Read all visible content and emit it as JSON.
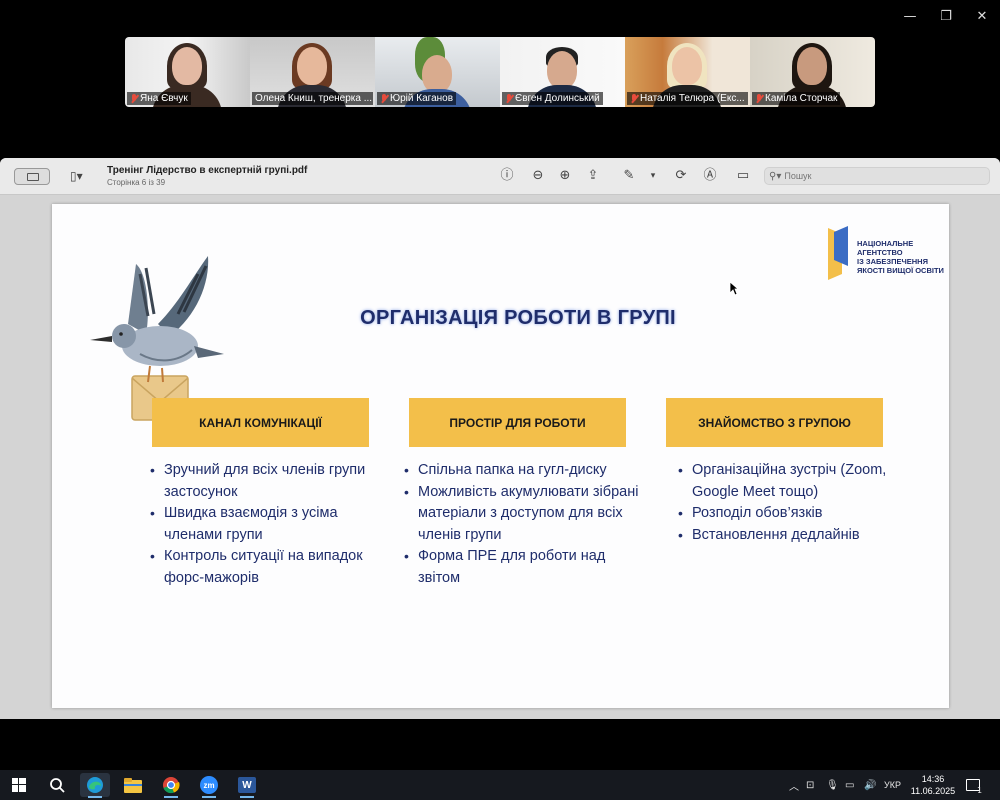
{
  "window_controls": {
    "minimize": "—",
    "restore": "❐",
    "close": "✕"
  },
  "participants": [
    {
      "name": "Яна Євчук",
      "muted": true
    },
    {
      "name": "Олена Книш, тренерка ...",
      "muted": true,
      "active": true
    },
    {
      "name": "Юрій Каганов",
      "muted": true
    },
    {
      "name": "Євген Долинський",
      "muted": true
    },
    {
      "name": "Наталія Телюра (Екс...",
      "muted": true
    },
    {
      "name": "Каміла  Сторчак",
      "muted": true
    }
  ],
  "viewer": {
    "doc_title": "Тренінг Лідерство в експертній групі.pdf",
    "doc_subtitle": "Сторінка 6 із 39",
    "search_placeholder": "Пошук"
  },
  "slide": {
    "title": "ОРГАНІЗАЦІЯ РОБОТИ В ГРУПІ",
    "logo_lines": [
      "НАЦІОНАЛЬНЕ",
      "АГЕНТСТВО",
      "ІЗ ЗАБЕЗПЕЧЕННЯ",
      "ЯКОСТІ ВИЩОЇ ОСВІТИ"
    ],
    "columns": [
      {
        "heading": "КАНАЛ КОМУНІКАЦІЇ",
        "items": [
          "Зручний для всіх членів групи застосунок",
          "Швидка взаємодія з усіма членами групи",
          "Контроль ситуації на випадок форс-мажорів"
        ]
      },
      {
        "heading": "ПРОСТІР ДЛЯ РОБОТИ",
        "items": [
          "Спільна папка на гугл-диску",
          "Можливість акумулювати зібрані матеріали з доступом для всіх членів групи",
          "Форма ПРЕ для роботи над звітом"
        ]
      },
      {
        "heading": "ЗНАЙОМСТВО З ГРУПОЮ",
        "items": [
          "Організаційна зустріч (Zoom, Google Meet тощо)",
          "Розподіл обов’язків",
          "Встановлення дедлайнів"
        ]
      }
    ],
    "colors": {
      "accent": "#f3bf4a",
      "text": "#1f2d6b"
    }
  },
  "taskbar": {
    "apps": [
      "windows-start",
      "search",
      "edge",
      "file-explorer",
      "chrome",
      "zoom",
      "word"
    ],
    "zoom_label": "zm",
    "word_label": "W",
    "language": "УКР",
    "time": "14:36",
    "date": "11.06.2025",
    "notifications_count": "1"
  }
}
